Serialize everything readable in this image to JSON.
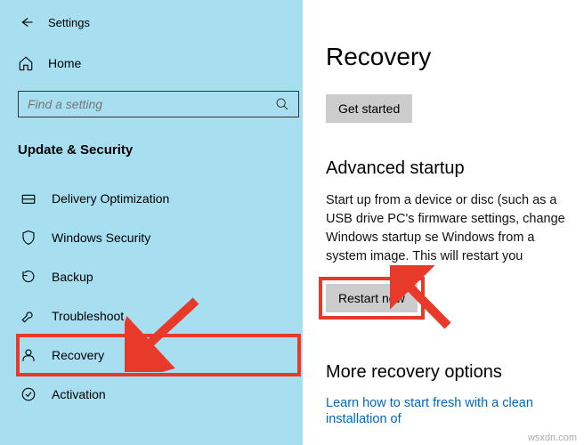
{
  "header": {
    "title": "Settings"
  },
  "home_label": "Home",
  "search": {
    "placeholder": "Find a setting"
  },
  "section_header": "Update & Security",
  "nav": {
    "items": [
      {
        "label": "Delivery Optimization"
      },
      {
        "label": "Windows Security"
      },
      {
        "label": "Backup"
      },
      {
        "label": "Troubleshoot"
      },
      {
        "label": "Recovery"
      },
      {
        "label": "Activation"
      }
    ]
  },
  "content": {
    "page_title": "Recovery",
    "get_started_label": "Get started",
    "adv_title": "Advanced startup",
    "adv_body": "Start up from a device or disc (such as a USB drive PC's firmware settings, change Windows startup se Windows from a system image. This will restart you",
    "restart_label": "Restart now",
    "more_title": "More recovery options",
    "more_link": "Learn how to start fresh with a clean installation of"
  },
  "watermark": "wsxdn.com",
  "colors": {
    "highlight": "#e83a2b",
    "sidebar": "#a8dff0",
    "link": "#0067c0"
  }
}
